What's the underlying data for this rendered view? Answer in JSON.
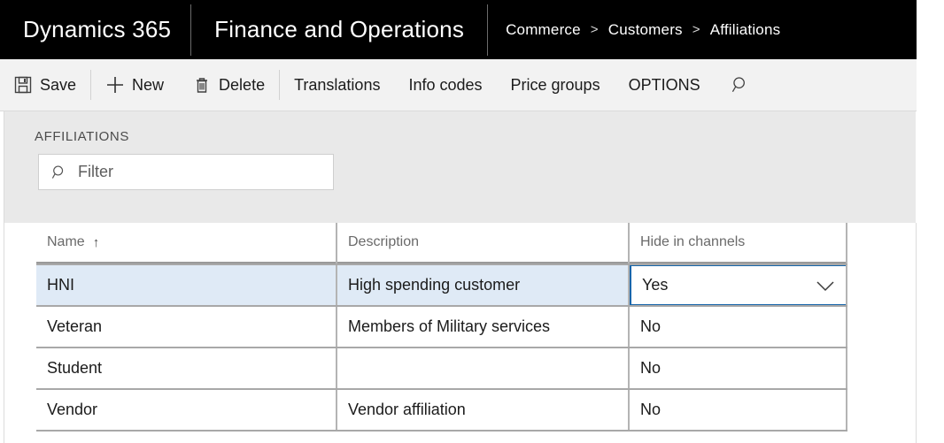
{
  "header": {
    "brand": "Dynamics 365",
    "module": "Finance and Operations",
    "breadcrumb": [
      "Commerce",
      "Customers",
      "Affiliations"
    ],
    "separator": ">"
  },
  "toolbar": {
    "items": [
      {
        "label": "Save",
        "icon": "save-icon"
      },
      {
        "label": "New",
        "icon": "plus-icon"
      },
      {
        "label": "Delete",
        "icon": "trash-icon"
      },
      {
        "label": "Translations",
        "icon": ""
      },
      {
        "label": "Info codes",
        "icon": ""
      },
      {
        "label": "Price groups",
        "icon": ""
      },
      {
        "label": "OPTIONS",
        "icon": ""
      }
    ],
    "search_icon": "search-icon"
  },
  "panel": {
    "title": "AFFILIATIONS",
    "filter": {
      "value": "",
      "placeholder": "Filter",
      "icon": "search-icon"
    }
  },
  "grid": {
    "columns": [
      {
        "label": "Name",
        "sort": "↑"
      },
      {
        "label": "Description",
        "sort": ""
      },
      {
        "label": "Hide in channels",
        "sort": ""
      }
    ],
    "rows": [
      {
        "name": "HNI",
        "description": "High spending customer",
        "hide": "Yes",
        "selected": true,
        "editing": true
      },
      {
        "name": "Veteran",
        "description": "Members of Military services",
        "hide": "No",
        "selected": false,
        "editing": false
      },
      {
        "name": "Student",
        "description": "",
        "hide": "No",
        "selected": false,
        "editing": false
      },
      {
        "name": "Vendor",
        "description": "Vendor affiliation",
        "hide": "No",
        "selected": false,
        "editing": false
      }
    ],
    "hide_options": [
      "Yes",
      "No"
    ],
    "dropdown_icon": "chevron-down-icon"
  },
  "colors": {
    "nav_background": "#000000",
    "toolbar_background": "#f2f2f2",
    "panel_background": "#e9e9e9",
    "selected_row": "#dfeaf6",
    "focus_border": "#1565ab",
    "grid_line": "#b4b4b4"
  }
}
